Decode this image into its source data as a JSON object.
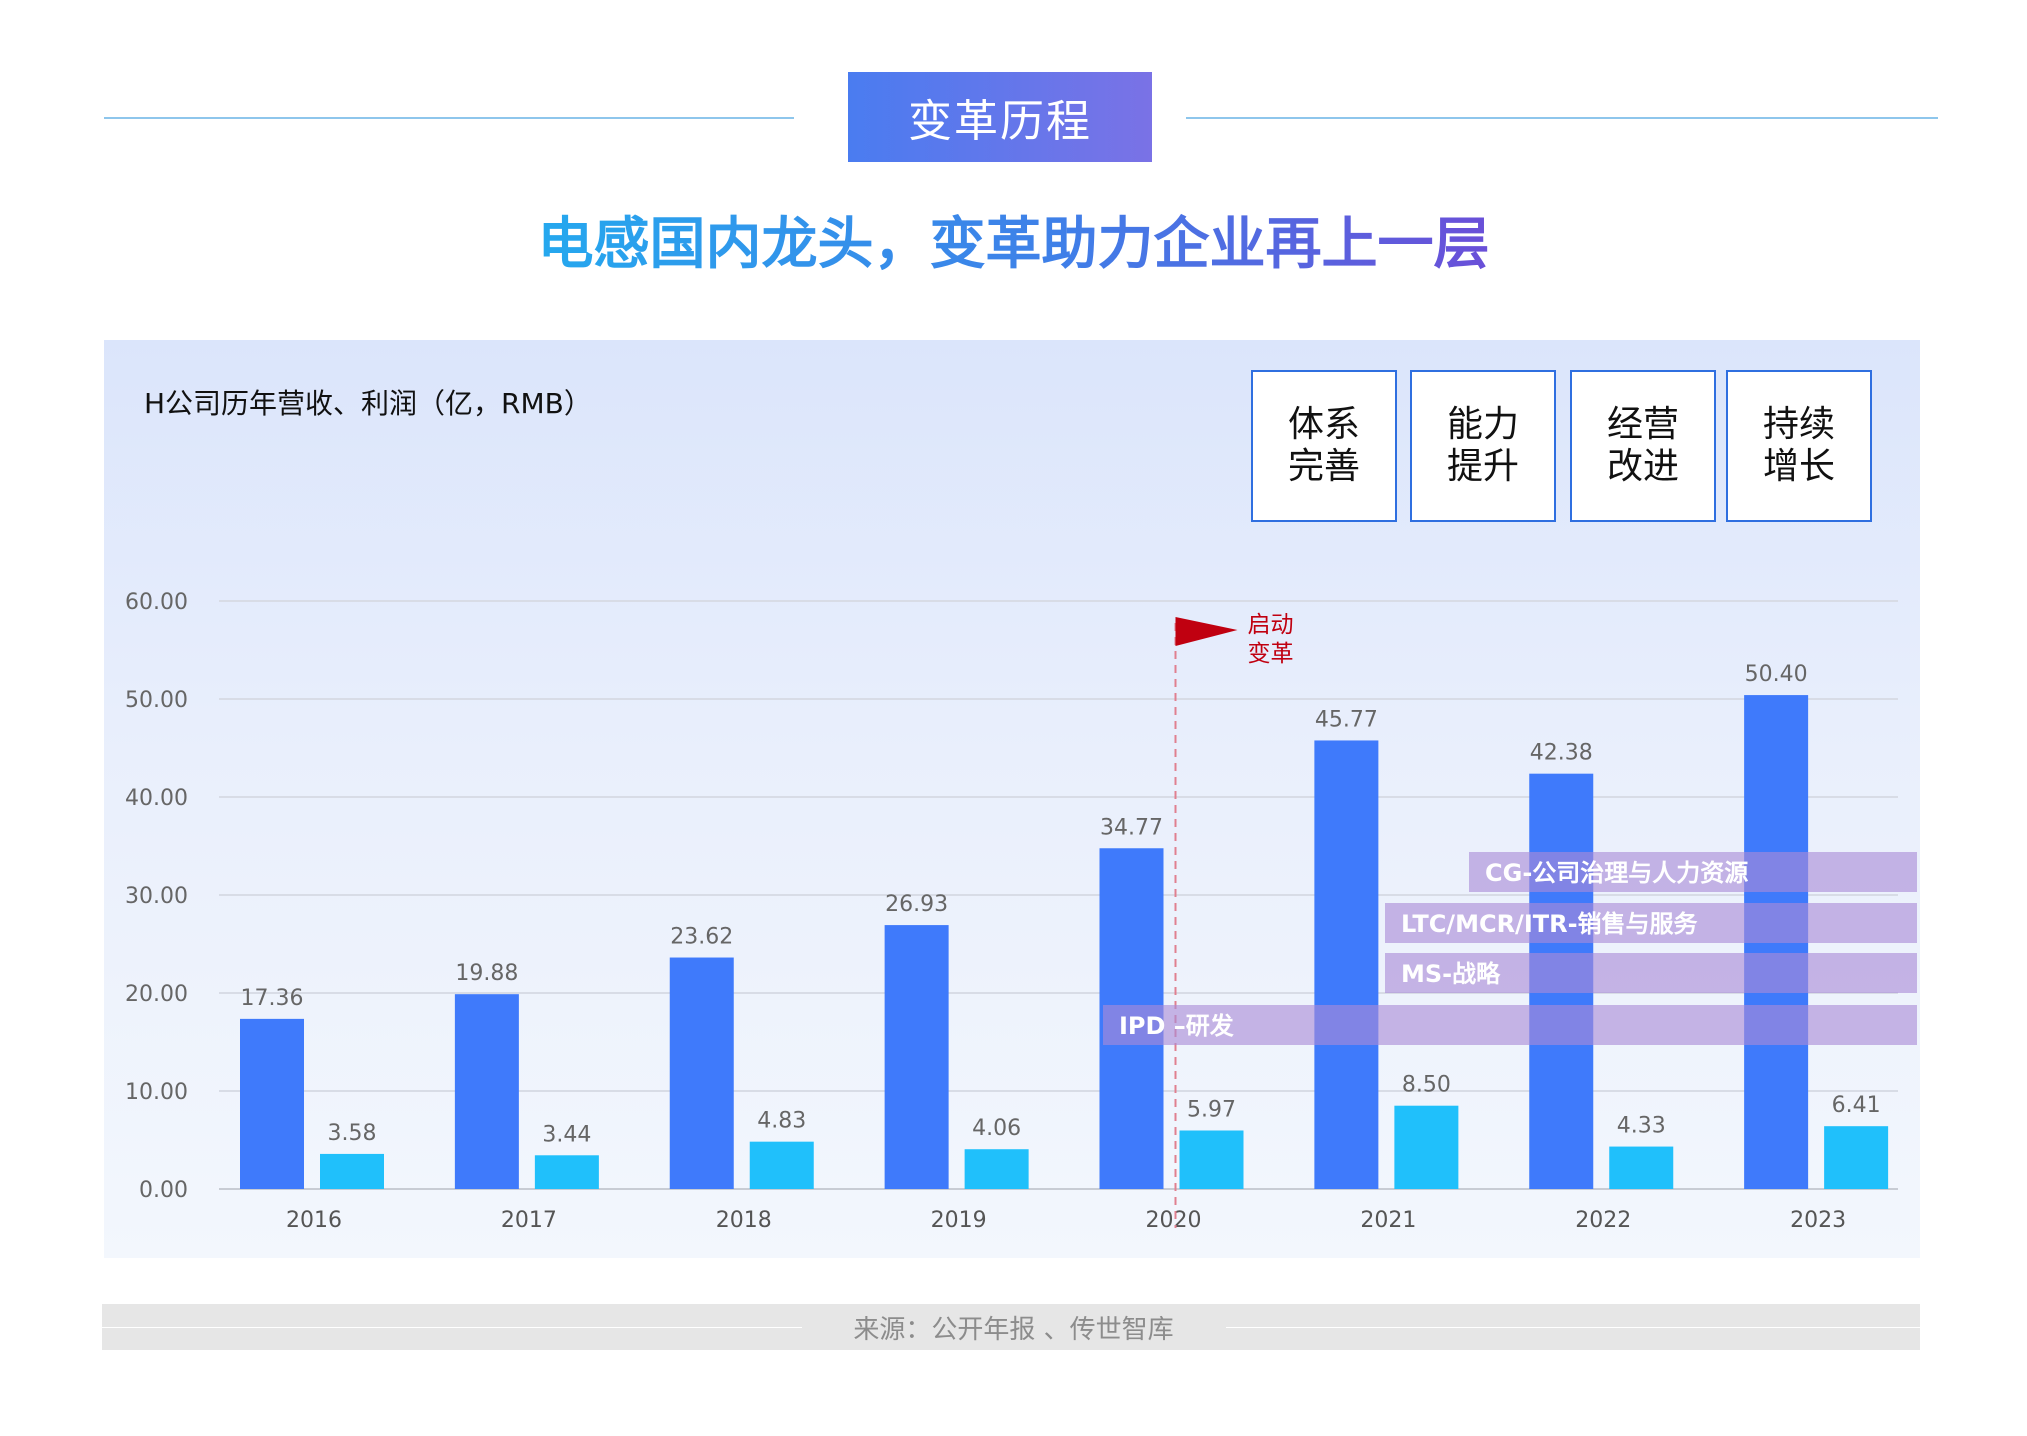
{
  "header": {
    "pill_title": "变革历程",
    "subtitle": "电感国内龙头，变革助力企业再上一层"
  },
  "panel": {
    "chart_title": "H公司历年营收、利润（亿，RMB）",
    "stage_boxes": [
      "体系完善",
      "能力提升",
      "经营改进",
      "持续增长"
    ]
  },
  "chart_data": {
    "type": "bar",
    "categories": [
      "2016",
      "2017",
      "2018",
      "2019",
      "2020",
      "2021",
      "2022",
      "2023"
    ],
    "series": [
      {
        "name": "",
        "values": [
          17.36,
          19.88,
          23.62,
          26.93,
          34.77,
          45.77,
          42.38,
          50.4
        ],
        "labels": [
          "17.36",
          "19.88",
          "23.62",
          "26.93",
          "34.77",
          "45.77",
          "42.38",
          "50.40"
        ],
        "color": "#3f7afb"
      },
      {
        "name": "",
        "values": [
          3.58,
          3.44,
          4.83,
          4.06,
          5.97,
          8.5,
          4.33,
          6.41
        ],
        "labels": [
          "3.58",
          "3.44",
          "4.83",
          "4.06",
          "5.97",
          "8.50",
          "4.33",
          "6.41"
        ],
        "color": "#20c0fb"
      }
    ],
    "ylim": [
      0,
      60
    ],
    "yticks": [
      "0.00",
      "10.00",
      "20.00",
      "30.00",
      "40.00",
      "50.00",
      "60.00"
    ],
    "grid": true,
    "annotations": {
      "change_marker": {
        "at_category": "2020",
        "label": [
          "启动",
          "变革"
        ],
        "color": "#c00010"
      },
      "bands": [
        {
          "label": "CG-公司治理与人力资源",
          "start_category": "2022"
        },
        {
          "label": "LTC/MCR/ITR-销售与服务",
          "start_category": "2022"
        },
        {
          "label": "MS-战略",
          "start_category": "2022"
        },
        {
          "label": "IPD –研发",
          "start_category": "2020"
        }
      ],
      "band_color": "#a98ad6"
    }
  },
  "footer": {
    "source": "来源：公开年报 、传世智库"
  }
}
